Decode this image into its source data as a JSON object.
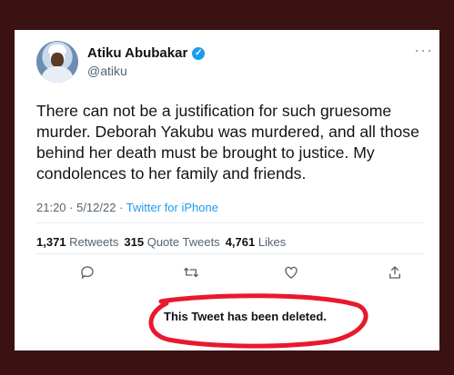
{
  "tweet": {
    "display_name": "Atiku Abubakar",
    "handle": "@atiku",
    "verified": true,
    "text": "There can not be a justification for such gruesome murder. Deborah Yakubu was murdered, and all those behind her death must be brought to justice. My condolences to her family and friends.",
    "time": "21:20 · 5/12/22 · ",
    "source": "Twitter for iPhone"
  },
  "stats": {
    "retweets_count": "1,371",
    "retweets_label": "Retweets",
    "quotes_count": "315",
    "quotes_label": "Quote Tweets",
    "likes_count": "4,761",
    "likes_label": "Likes"
  },
  "actions": [
    {
      "icon": "reply-icon"
    },
    {
      "icon": "retweet-icon"
    },
    {
      "icon": "like-icon"
    },
    {
      "icon": "share-icon"
    }
  ],
  "notice": {
    "text": "This Tweet has been deleted."
  },
  "colors": {
    "accent": "#1d9bf0",
    "annotation": "#e8192c",
    "background": "#3a1212"
  }
}
